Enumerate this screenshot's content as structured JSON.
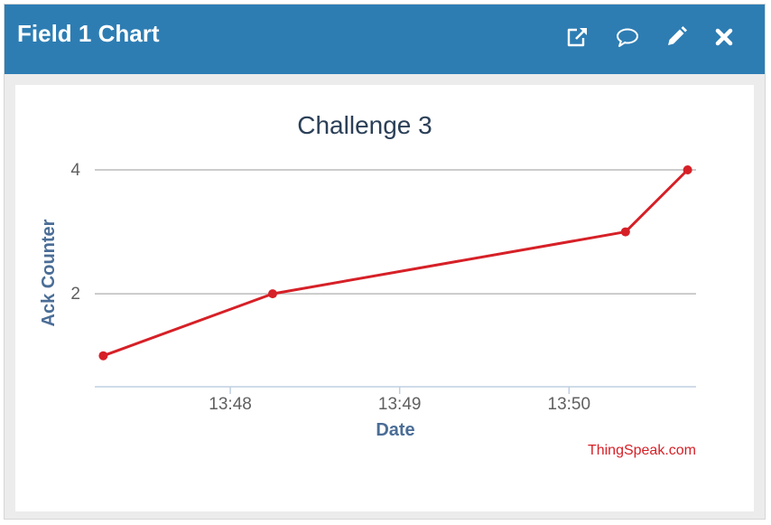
{
  "header": {
    "title": "Field 1 Chart",
    "icons": [
      "external-link-icon",
      "comment-icon",
      "pencil-icon",
      "close-icon"
    ]
  },
  "colors": {
    "header_bg": "#2d7db3",
    "series": "#d62027",
    "axis_title": "#4a6d96",
    "credit": "#d62027"
  },
  "chart_data": {
    "type": "line",
    "title": "Challenge 3",
    "xlabel": "Date",
    "ylabel": "Ack Counter",
    "credit": "ThingSpeak.com",
    "x_axis": "time",
    "xlim": [
      "13:47:12",
      "13:50:45"
    ],
    "ylim": [
      0.5,
      4.0
    ],
    "x_ticks": [
      "13:48",
      "13:49",
      "13:50"
    ],
    "y_ticks": [
      2,
      4
    ],
    "grid": true,
    "series": [
      {
        "points": [
          {
            "x": "13:47:15",
            "y": 1
          },
          {
            "x": "13:48:15",
            "y": 2
          },
          {
            "x": "13:50:20",
            "y": 3
          },
          {
            "x": "13:50:42",
            "y": 4
          }
        ]
      }
    ]
  }
}
